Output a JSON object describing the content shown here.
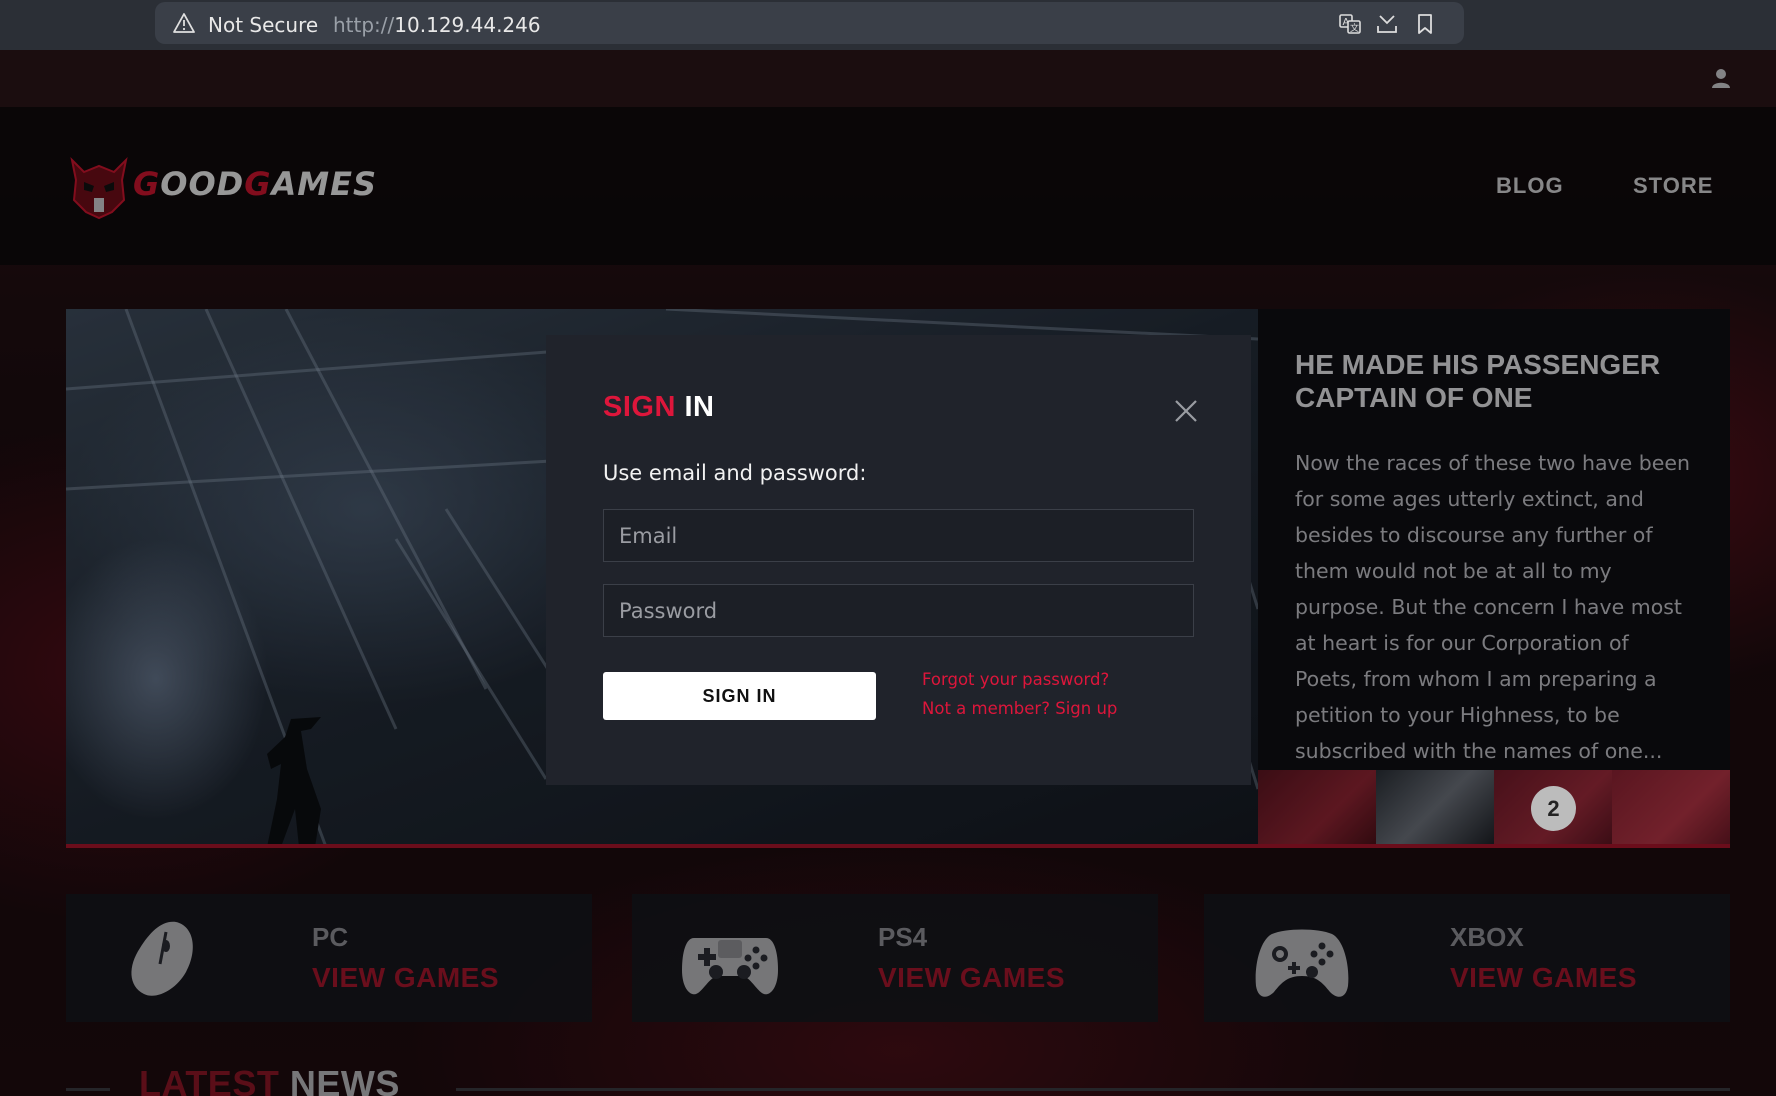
{
  "browser": {
    "security_label": "Not Secure",
    "url_scheme": "http://",
    "url_host": "10.129.44.246",
    "icons": [
      "warning-icon",
      "translate-icon",
      "download-icon",
      "bookmark-icon"
    ]
  },
  "header": {
    "logo_text_1": "G",
    "logo_text_2": "OOD",
    "logo_text_3": "G",
    "logo_text_4": "AMES",
    "nav": [
      {
        "label": "BLOG"
      },
      {
        "label": "STORE"
      }
    ],
    "user_icon": "user-icon"
  },
  "hero": {
    "side_title": "HE MADE HIS PASSENGER CAPTAIN OF ONE",
    "side_text": "Now the races of these two have been for some ages utterly extinct, and besides to discourse any further of them would not be at all to my purpose. But the concern I have most at heart is for our Corporation of Poets, from whom I am preparing a petition to your Highness, to be subscribed with the names of one...",
    "slide_number": "2"
  },
  "modal": {
    "title_part1": "SIGN",
    "title_part2": "IN",
    "subtitle": "Use email and password:",
    "email_placeholder": "Email",
    "password_placeholder": "Password",
    "email_value": "",
    "password_value": "",
    "signin_label": "SIGN IN",
    "forgot_label": "Forgot your password?",
    "signup_label": "Not a member? Sign up"
  },
  "platforms": [
    {
      "name": "PC",
      "link": "VIEW GAMES",
      "icon": "mouse-icon"
    },
    {
      "name": "PS4",
      "link": "VIEW GAMES",
      "icon": "ps4-controller-icon"
    },
    {
      "name": "XBOX",
      "link": "VIEW GAMES",
      "icon": "xbox-controller-icon"
    }
  ],
  "news": {
    "title_part1": "LATEST",
    "title_part2": "NEWS"
  },
  "colors": {
    "accent": "#dd163b",
    "dark_accent": "#a3162b",
    "modal_bg": "#20232b"
  }
}
